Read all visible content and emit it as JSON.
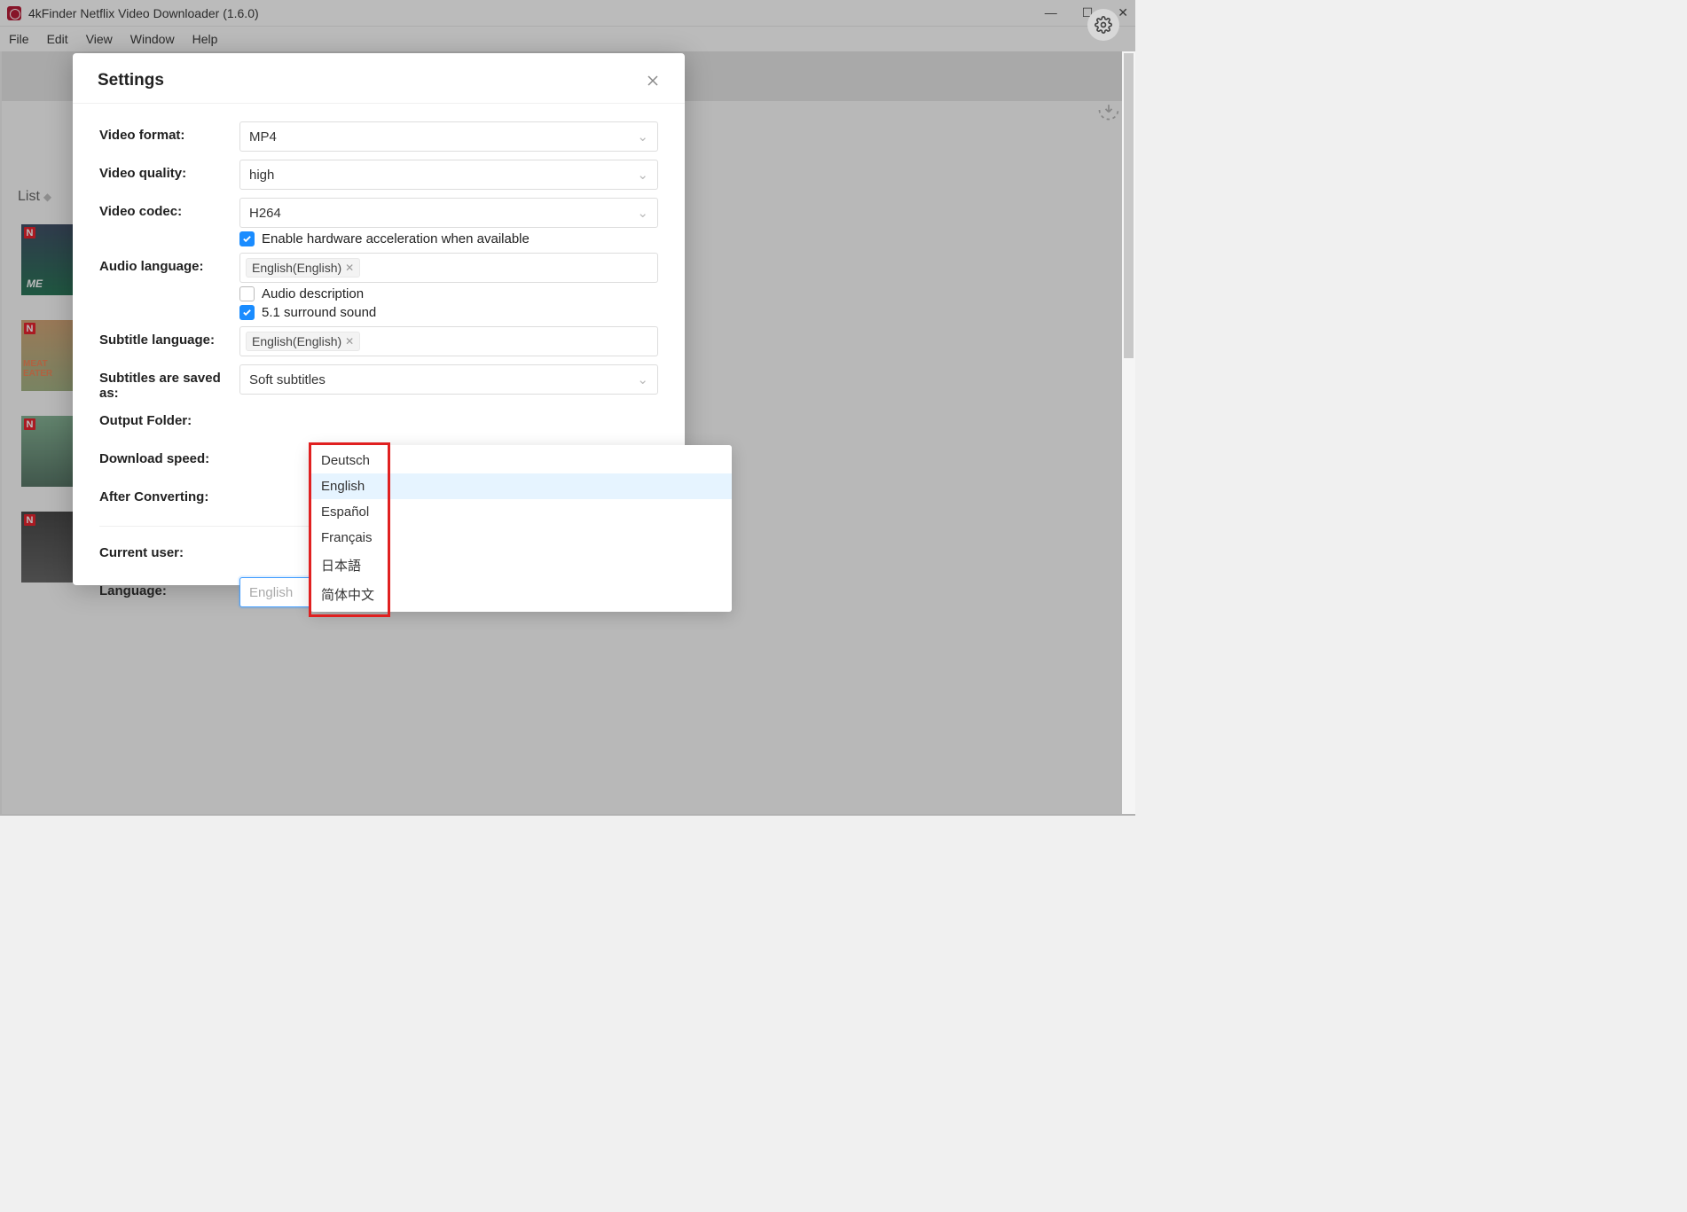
{
  "titlebar": {
    "title": "4kFinder Netflix Video Downloader (1.6.0)"
  },
  "menubar": [
    "File",
    "Edit",
    "View",
    "Window",
    "Help"
  ],
  "sidebar": {
    "list_label": "List"
  },
  "modal": {
    "title": "Settings",
    "labels": {
      "video_format": "Video format:",
      "video_quality": "Video quality:",
      "video_codec": "Video codec:",
      "audio_language": "Audio language:",
      "subtitle_language": "Subtitle language:",
      "subtitles_saved": "Subtitles are saved as:",
      "output_folder": "Output Folder:",
      "download_speed": "Download speed:",
      "after_converting": "After Converting:",
      "current_user": "Current user:",
      "language": "Language:"
    },
    "values": {
      "video_format": "MP4",
      "video_quality": "high",
      "video_codec": "H264",
      "hw_accel": "Enable hardware acceleration when available",
      "audio_tag": "English(English)",
      "audio_desc": "Audio description",
      "surround": "5.1 surround sound",
      "subtitle_tag": "English(English)",
      "subtitles_saved": "Soft subtitles",
      "language_placeholder": "English"
    },
    "dropdown": [
      "Deutsch",
      "English",
      "Español",
      "Français",
      "日本語",
      "简体中文"
    ]
  }
}
